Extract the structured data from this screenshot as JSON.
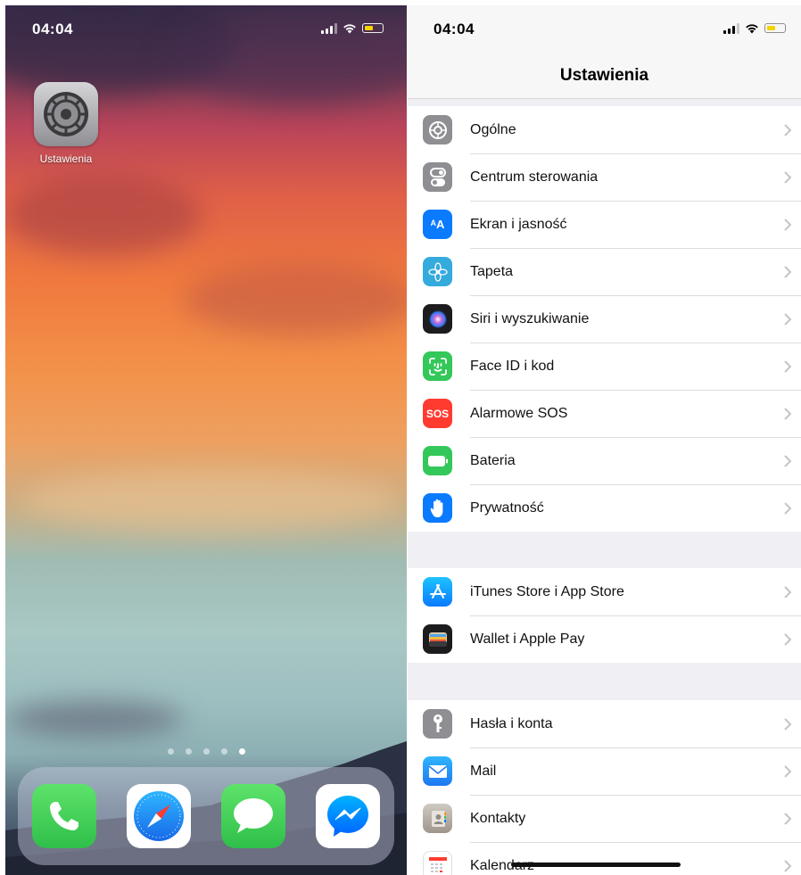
{
  "home": {
    "status_time": "04:04",
    "app_label": "Ustawienia",
    "page_dots": {
      "count": 5,
      "active_index": 4
    },
    "dock_icons": [
      "phone-icon",
      "safari-icon",
      "messages-icon",
      "messenger-icon"
    ],
    "colors": {
      "phone": "#34c759",
      "messages": "#34c759",
      "safari": "#1e88ff",
      "messenger": "#0a7cff"
    }
  },
  "settings": {
    "status_time": "04:04",
    "title": "Ustawienia",
    "groups": [
      [
        {
          "label": "Ogólne",
          "icon": "gear-icon",
          "color": "#8e8e93"
        },
        {
          "label": "Centrum sterowania",
          "icon": "switches-icon",
          "color": "#8e8e93"
        },
        {
          "label": "Ekran i jasność",
          "icon": "text-size-icon",
          "color": "#0a7aff"
        },
        {
          "label": "Tapeta",
          "icon": "flower-icon",
          "color": "#35aadc"
        },
        {
          "label": "Siri i wyszukiwanie",
          "icon": "siri-icon",
          "color": "#1c1c1e"
        },
        {
          "label": "Face ID i kod",
          "icon": "face-id-icon",
          "color": "#34c759"
        },
        {
          "label": "Alarmowe SOS",
          "icon": "sos-icon",
          "color": "#ff3b30"
        },
        {
          "label": "Bateria",
          "icon": "battery-icon",
          "color": "#34c759"
        },
        {
          "label": "Prywatność",
          "icon": "hand-icon",
          "color": "#0a7aff"
        }
      ],
      [
        {
          "label": "iTunes Store i App Store",
          "icon": "app-store-icon",
          "color": "#0a7aff"
        },
        {
          "label": "Wallet i Apple Pay",
          "icon": "wallet-icon",
          "color": "#1c1c1e"
        }
      ],
      [
        {
          "label": "Hasła i konta",
          "icon": "key-icon",
          "color": "#8e8e93"
        },
        {
          "label": "Mail",
          "icon": "mail-icon",
          "color": "#1e90ff"
        },
        {
          "label": "Kontakty",
          "icon": "contacts-icon",
          "color": "#a8a29a"
        },
        {
          "label": "Kalendarz",
          "icon": "calendar-icon",
          "color": "#ffffff"
        }
      ]
    ]
  }
}
